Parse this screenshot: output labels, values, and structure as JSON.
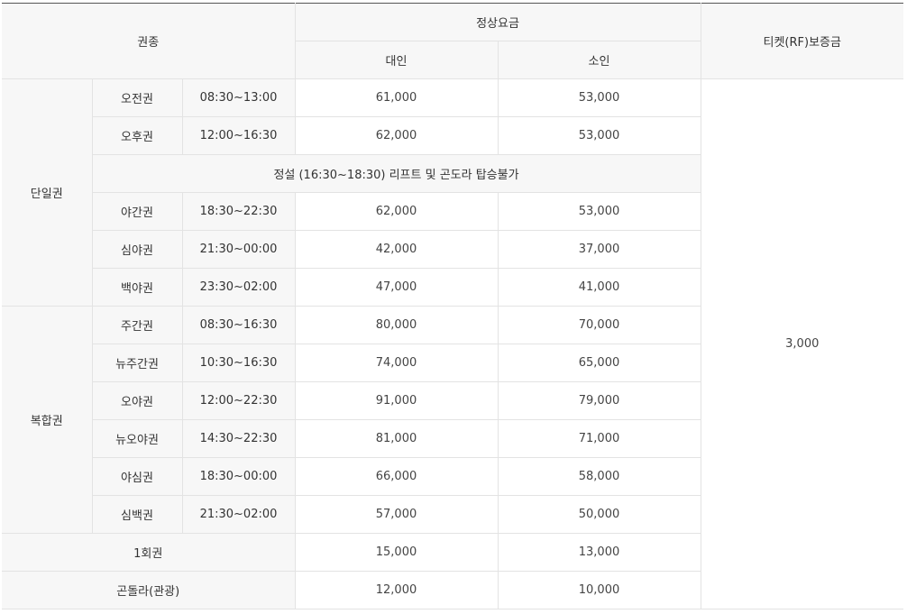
{
  "header": {
    "type_label": "권종",
    "regular_fare_label": "정상요금",
    "adult_label": "대인",
    "child_label": "소인",
    "deposit_label": "티켓(RF)보증금"
  },
  "deposit_value": "3,000",
  "single": {
    "group_label": "단일권",
    "rows": [
      {
        "name": "오전권",
        "time": "08:30~13:00",
        "adult": "61,000",
        "child": "53,000"
      },
      {
        "name": "오후권",
        "time": "12:00~16:30",
        "adult": "62,000",
        "child": "53,000"
      },
      {
        "name": "야간권",
        "time": "18:30~22:30",
        "adult": "62,000",
        "child": "53,000"
      },
      {
        "name": "심야권",
        "time": "21:30~00:00",
        "adult": "42,000",
        "child": "37,000"
      },
      {
        "name": "백야권",
        "time": "23:30~02:00",
        "adult": "47,000",
        "child": "41,000"
      }
    ],
    "notice": "정설 (16:30~18:30) 리프트 및 곤도라 탑승불가"
  },
  "combo": {
    "group_label": "복합권",
    "rows": [
      {
        "name": "주간권",
        "time": "08:30~16:30",
        "adult": "80,000",
        "child": "70,000"
      },
      {
        "name": "뉴주간권",
        "time": "10:30~16:30",
        "adult": "74,000",
        "child": "65,000"
      },
      {
        "name": "오야권",
        "time": "12:00~22:30",
        "adult": "91,000",
        "child": "79,000"
      },
      {
        "name": "뉴오야권",
        "time": "14:30~22:30",
        "adult": "81,000",
        "child": "71,000"
      },
      {
        "name": "야심권",
        "time": "18:30~00:00",
        "adult": "66,000",
        "child": "58,000"
      },
      {
        "name": "심백권",
        "time": "21:30~02:00",
        "adult": "57,000",
        "child": "50,000"
      }
    ]
  },
  "extra": [
    {
      "name": "1회권",
      "adult": "15,000",
      "child": "13,000"
    },
    {
      "name": "곤돌라(관광)",
      "adult": "12,000",
      "child": "10,000"
    }
  ]
}
